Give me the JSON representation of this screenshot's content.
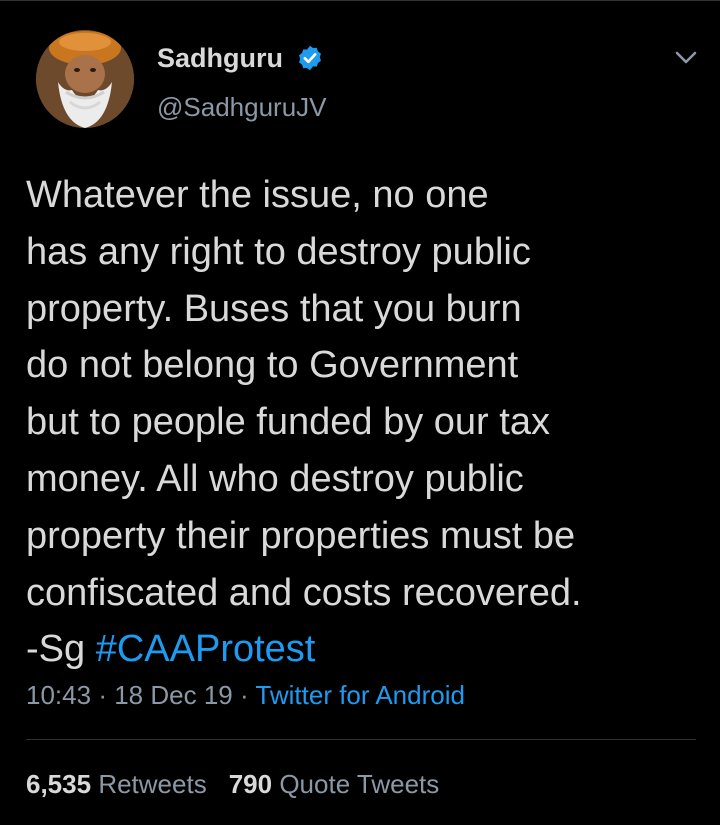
{
  "author": {
    "display_name": "Sadhguru",
    "handle": "@SadhguruJV",
    "verified": true,
    "avatar_icon": "profile-photo"
  },
  "tweet": {
    "lines": [
      "Whatever the issue, no one",
      "has any right to destroy public",
      "property. Buses that you burn",
      "do not belong to Government",
      "but to people funded by our tax",
      "money. All who destroy public",
      "property their properties must be",
      "confiscated and costs recovered."
    ],
    "signature": "-Sg",
    "hashtag": "#CAAProtest"
  },
  "meta": {
    "time": "10:43",
    "separator": "·",
    "date": "18 Dec 19",
    "source": "Twitter for Android"
  },
  "stats": {
    "retweets_count": "6,535",
    "retweets_label": "Retweets",
    "quote_count": "790",
    "quote_label": "Quote Tweets"
  },
  "colors": {
    "background": "#000000",
    "text": "#d9d9d9",
    "secondary": "#8b98a5",
    "accent": "#1d9bf0",
    "divider": "#2f3336"
  },
  "icons": {
    "verified": "verified-badge-icon",
    "menu": "chevron-down-icon"
  }
}
